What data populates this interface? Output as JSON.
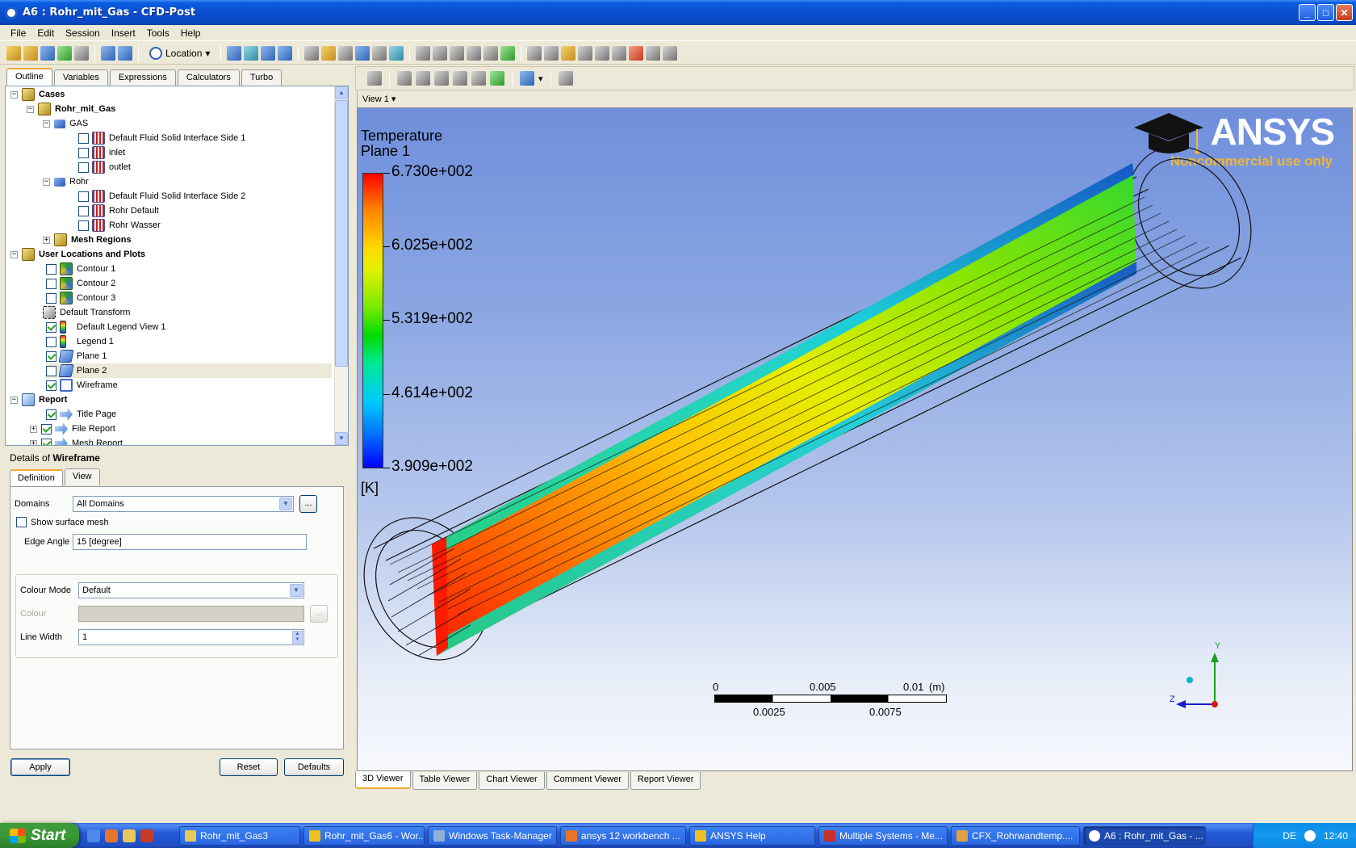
{
  "window": {
    "title": "A6 : Rohr_mit_Gas - CFD-Post"
  },
  "menu": [
    "File",
    "Edit",
    "Session",
    "Insert",
    "Tools",
    "Help"
  ],
  "toolbar": {
    "location_label": "Location"
  },
  "left_tabs": [
    "Outline",
    "Variables",
    "Expressions",
    "Calculators",
    "Turbo"
  ],
  "tree": {
    "cases": "Cases",
    "case_name": "Rohr_mit_Gas",
    "gas": "GAS",
    "gas_items": [
      "Default Fluid Solid Interface Side 1",
      "inlet",
      "outlet"
    ],
    "rohr": "Rohr",
    "rohr_items": [
      "Default Fluid Solid Interface Side 2",
      "Rohr Default",
      "Rohr Wasser"
    ],
    "mesh_regions": "Mesh Regions",
    "user_locations": "User Locations and Plots",
    "contour1": "Contour 1",
    "contour2": "Contour 2",
    "contour3": "Contour 3",
    "default_transform": "Default Transform",
    "default_legend": "Default Legend View 1",
    "legend1": "Legend 1",
    "plane1": "Plane 1",
    "plane2": "Plane 2",
    "wireframe": "Wireframe",
    "report": "Report",
    "title_page": "Title Page",
    "file_report": "File Report",
    "mesh_report": "Mesh Report"
  },
  "details": {
    "prefix": "Details of ",
    "object": "Wireframe",
    "tabs": [
      "Definition",
      "View"
    ],
    "domains_label": "Domains",
    "domains_value": "All Domains",
    "show_mesh_label": "Show surface mesh",
    "edge_angle_label": "Edge Angle",
    "edge_angle_value": "15 [degree]",
    "colour_mode_label": "Colour Mode",
    "colour_mode_value": "Default",
    "colour_label": "Colour",
    "line_width_label": "Line Width",
    "line_width_value": "1",
    "dots": "..."
  },
  "buttons": {
    "apply": "Apply",
    "reset": "Reset",
    "defaults": "Defaults"
  },
  "viewer": {
    "view_name": "View 1",
    "legend_title": "Temperature",
    "legend_subtitle": "Plane 1",
    "legend_values": [
      "6.730e+002",
      "6.025e+002",
      "5.319e+002",
      "4.614e+002",
      "3.909e+002"
    ],
    "legend_unit": "[K]",
    "logo": "ANSYS",
    "logo_sub": "Noncommercial use only",
    "scale_top": [
      "0",
      "0.005",
      "0.01",
      "(m)"
    ],
    "scale_bottom": [
      "0.0025",
      "0.0075"
    ],
    "axis_y": "Y",
    "axis_z": "Z",
    "tabs": [
      "3D Viewer",
      "Table Viewer",
      "Chart Viewer",
      "Comment Viewer",
      "Report Viewer"
    ]
  },
  "taskbar": {
    "start": "Start",
    "tasks": [
      "Rohr_mit_Gas3",
      "Rohr_mit_Gas6 - Wor...",
      "Windows Task-Manager",
      "ansys 12 workbench ...",
      "ANSYS Help",
      "Multiple Systems - Me...",
      "CFX_Rohrwandtemp....",
      "A6 : Rohr_mit_Gas - ..."
    ],
    "lang": "DE",
    "clock": "12:40"
  }
}
